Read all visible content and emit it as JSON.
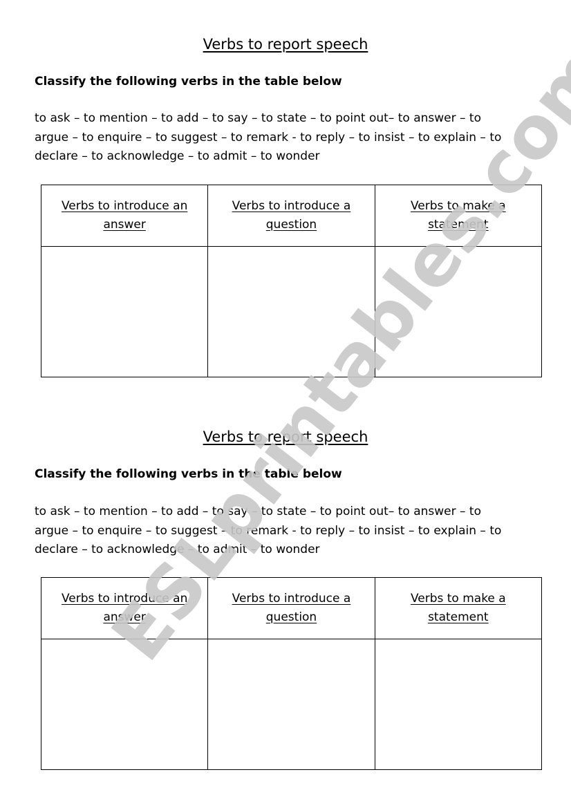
{
  "worksheets": [
    {
      "title": "Verbs to report speech",
      "instruction": "Classify the following verbs in the table below",
      "verb_lines": [
        "to ask – to mention – to add – to say – to state – to point out– to answer – to",
        "argue – to enquire – to suggest – to remark - to reply – to insist – to explain – to",
        "declare – to acknowledge – to admit – to wonder"
      ],
      "table_headers": [
        "Verbs to introduce an answer",
        "Verbs to introduce a question",
        "Verbs to make a statement"
      ]
    },
    {
      "title": "Verbs to report speech",
      "instruction": "Classify the following verbs in the table below",
      "verb_lines": [
        "to ask – to mention – to add – to say – to state – to point out– to answer – to",
        "argue – to enquire – to suggest – to remark - to reply – to insist – to explain – to",
        "declare – to acknowledge – to admit – to wonder"
      ],
      "table_headers": [
        "Verbs to introduce an answer",
        "Verbs to introduce a question",
        "Verbs to make a statement"
      ]
    }
  ],
  "watermark": {
    "text": "ESLprintables.com",
    "color": "#c8c8c8"
  }
}
